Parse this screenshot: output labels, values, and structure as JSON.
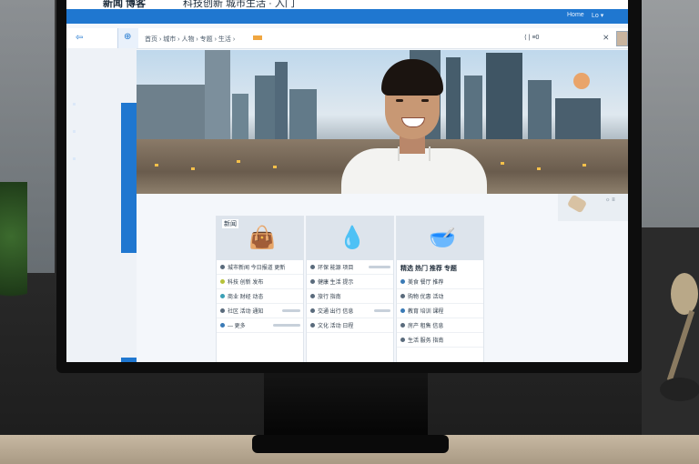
{
  "window": {
    "title": "新闻 博客",
    "subtitle": "科技创新 城市生活 · 入门"
  },
  "bluebar": {
    "right_1": "Home",
    "right_2": "Lo ▾"
  },
  "toolbar": {
    "back": "⇦",
    "nav": "⊕",
    "breadcrumb": "首页 › 城市 › 人物 › 专题 › 生活 ›",
    "right": "⟨  |  ≡0",
    "close": "⨯"
  },
  "deco": {
    "label": "☼ ≡"
  },
  "cards": [
    {
      "head": "新闻",
      "icon": "👜",
      "icon_name": "bag-icon",
      "title": "",
      "rows": [
        "城市新闻 今日报道 更新",
        "科技 创新 发布",
        "商业 财经 动态",
        "社区 活动 通知",
        "— 更多"
      ]
    },
    {
      "head": "",
      "icon": "💧",
      "icon_name": "drop-icon",
      "title": "",
      "rows": [
        "环保 能源 项目",
        "健康 生活 提示",
        "旅行 指南",
        "交通 出行 信息",
        "文化 活动 日程"
      ]
    },
    {
      "head": "",
      "icon": "🥣",
      "icon_name": "bowl-icon",
      "title": "精选 热门 推荐 专题",
      "rows": [
        "美食 餐厅 推荐",
        "购物 优惠 活动",
        "教育 培训 课程",
        "房产 租售 信息",
        "生活 服务 指南"
      ]
    }
  ],
  "colors": {
    "accent": "#1f77d0"
  }
}
